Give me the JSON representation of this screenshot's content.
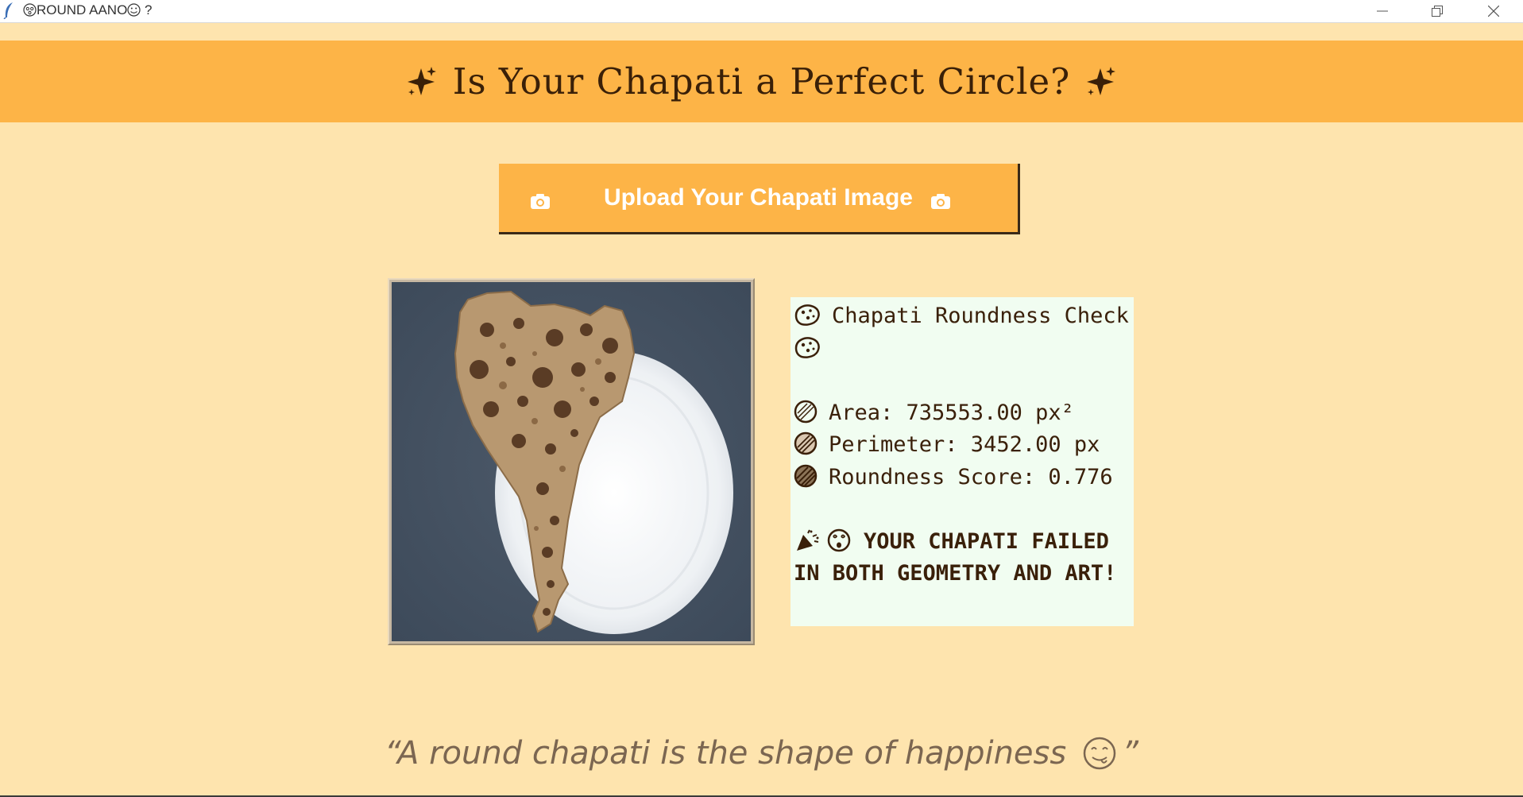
{
  "window": {
    "title": "ROUND AANO",
    "title_suffix": "?"
  },
  "header": {
    "title": "Is Your Chapati a Perfect Circle?",
    "accent_color": "#fdb447",
    "background_color": "#fee4ae"
  },
  "upload": {
    "label": "Upload Your Chapati Image"
  },
  "results": {
    "heading": "Chapati Roundness Check",
    "area": "Area: 735553.00 px²",
    "perimeter": "Perimeter: 3452.00 px",
    "roundness": "Roundness Score: 0.776",
    "verdict": "YOUR CHAPATI FAILED IN BOTH GEOMETRY AND ART!"
  },
  "footer": {
    "quote_text": "“A round chapati is the shape of happiness",
    "quote_close": "”"
  },
  "icons": {
    "title_left": "sparkles-icon",
    "title_right": "sparkles-icon",
    "upload_left": "camera-icon",
    "upload_right": "camera-icon",
    "heading_left": "flatbread-icon",
    "heading_right": "flatbread-icon",
    "area": "circle-icon",
    "perimeter": "circle-icon",
    "roundness": "circle-icon",
    "verdict_1": "party-popper-icon",
    "verdict_2": "dizzy-face-icon",
    "quote": "yum-face-icon"
  }
}
